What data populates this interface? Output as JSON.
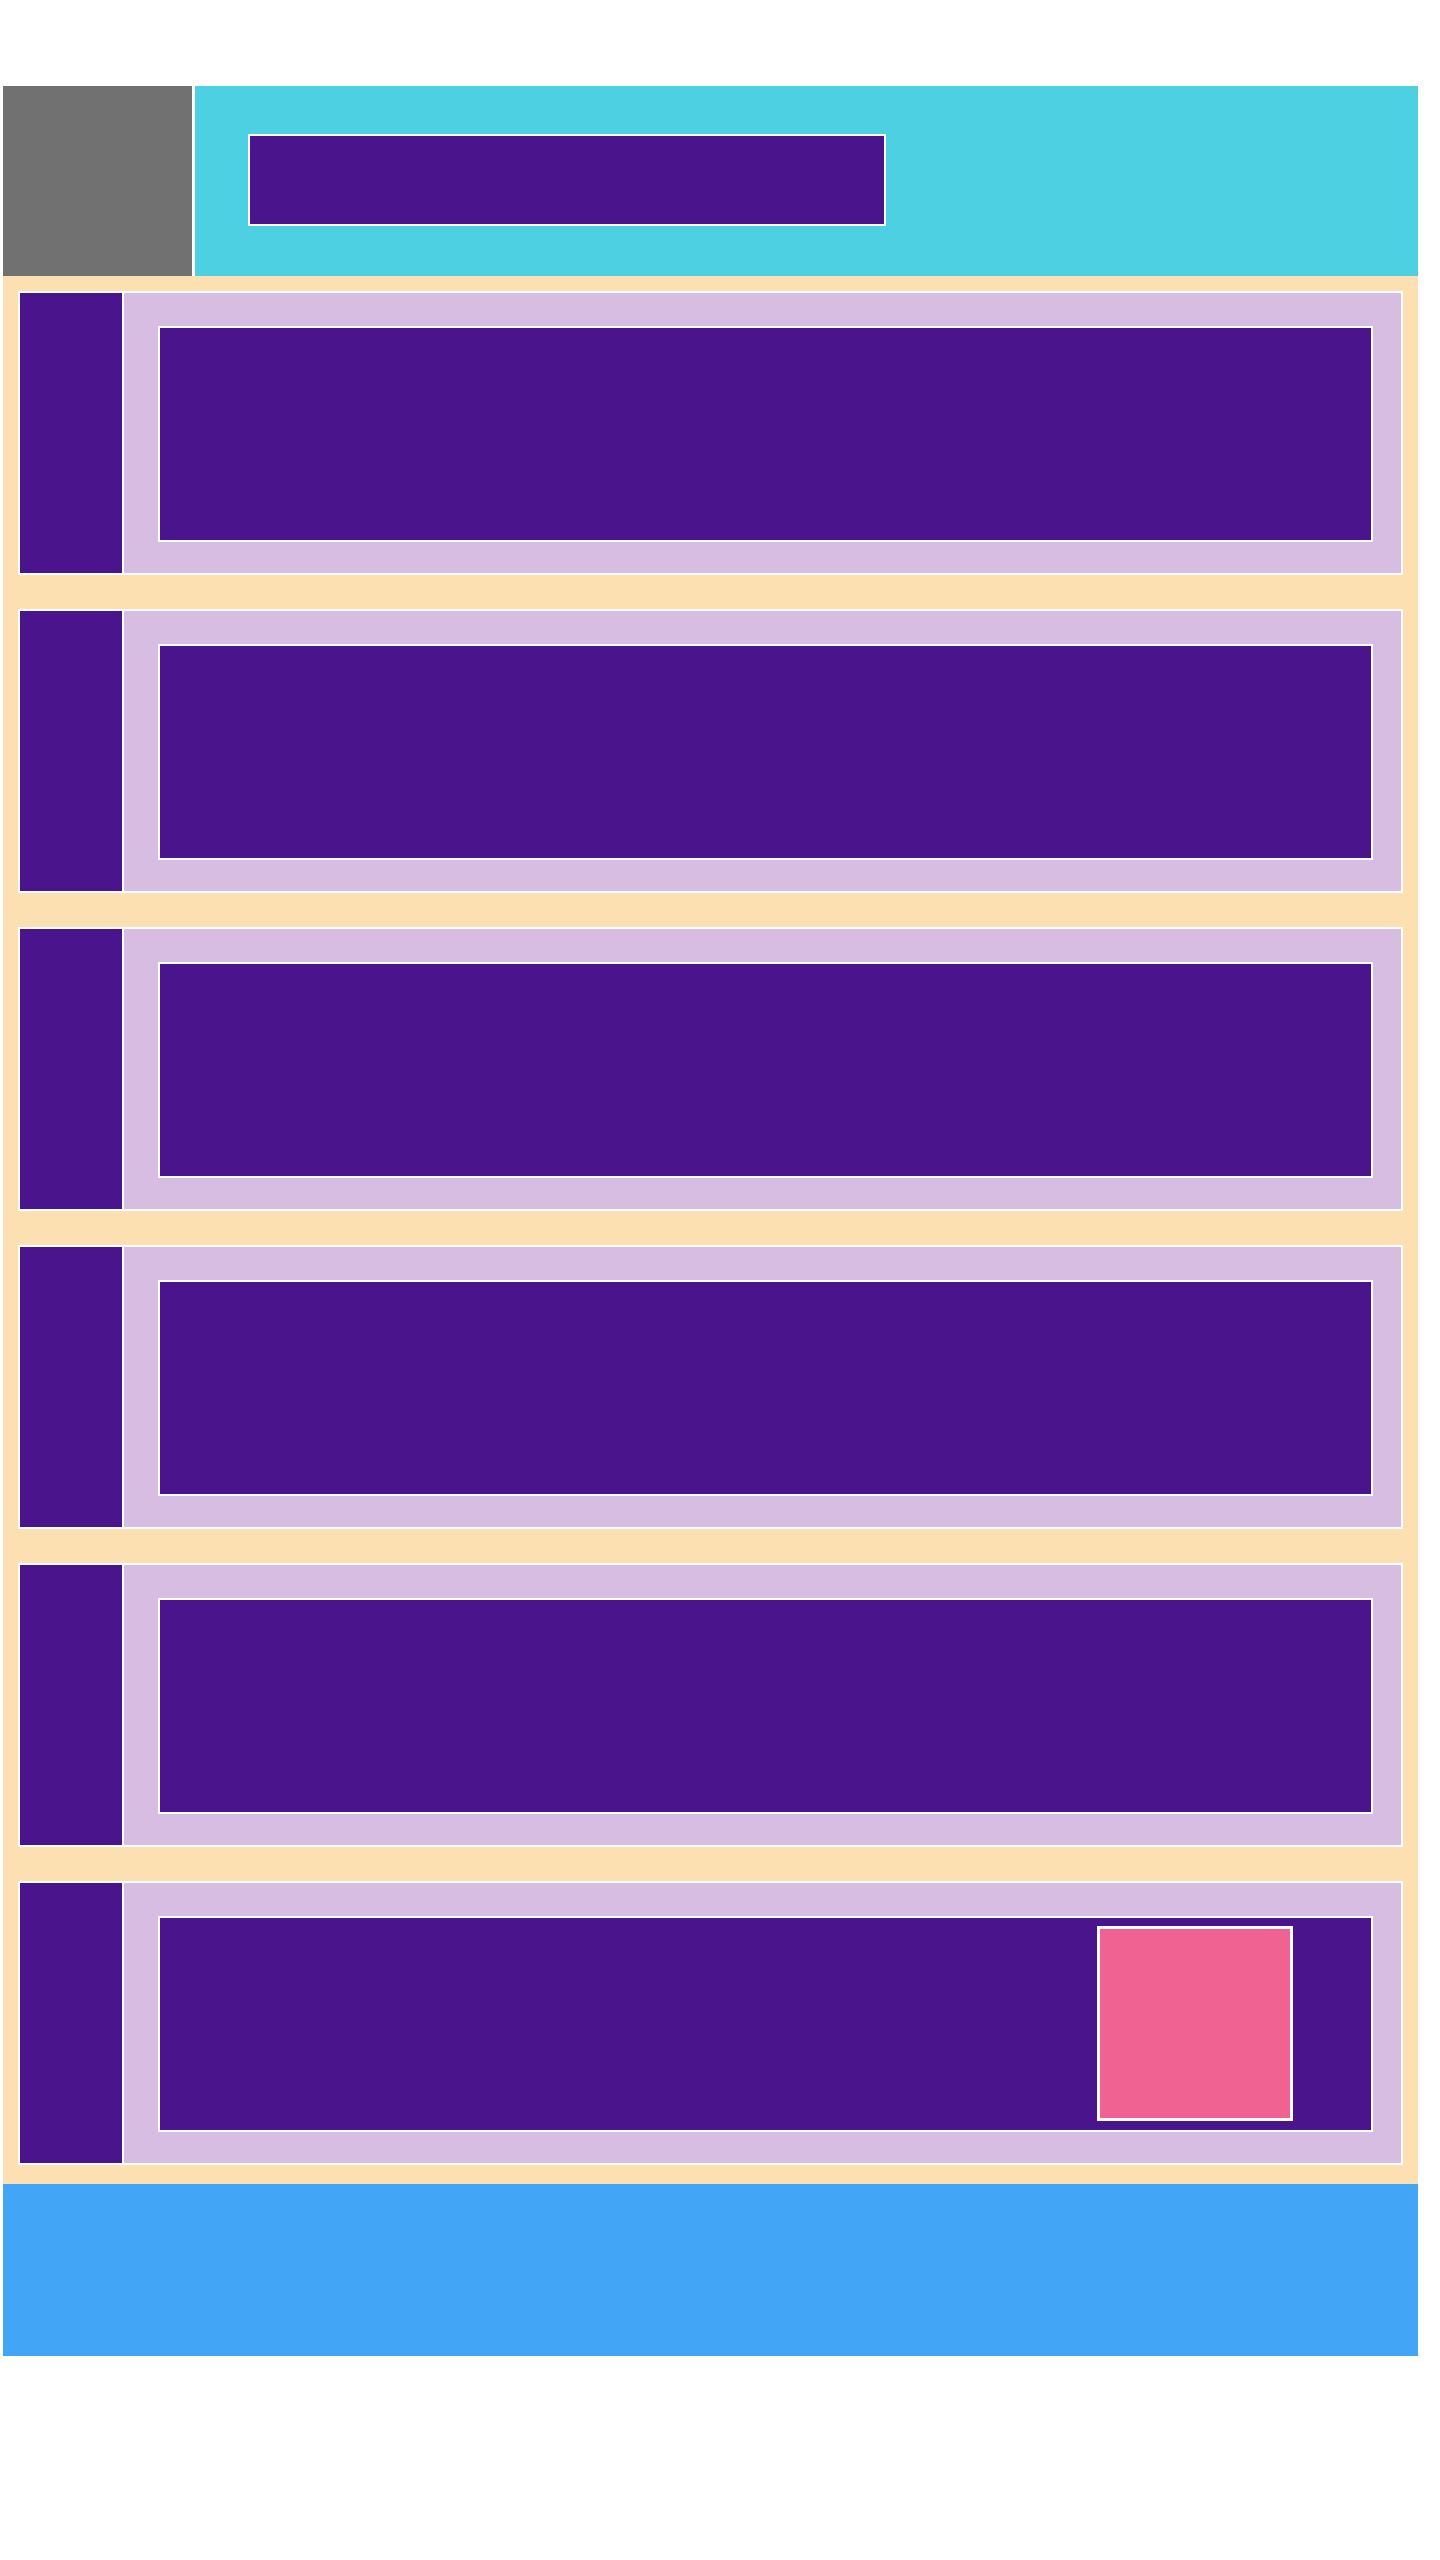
{
  "colors": {
    "page_background": "#ffffff",
    "avatar": "#717171",
    "header": "#4dd0e2",
    "title_bar": "#4a148c",
    "card_background": "#fde0b2",
    "card_inner": "#d8bde2",
    "card_marker": "#4a148c",
    "card_content": "#4a148c",
    "action_button": "#f06292",
    "footer": "#42a5f5"
  },
  "header": {
    "avatar": "",
    "title": ""
  },
  "cards": [
    {
      "marker": "",
      "content": ""
    },
    {
      "marker": "",
      "content": ""
    },
    {
      "marker": "",
      "content": ""
    },
    {
      "marker": "",
      "content": ""
    },
    {
      "marker": "",
      "content": ""
    },
    {
      "marker": "",
      "content": "",
      "action": ""
    }
  ],
  "footer": {
    "text": ""
  }
}
